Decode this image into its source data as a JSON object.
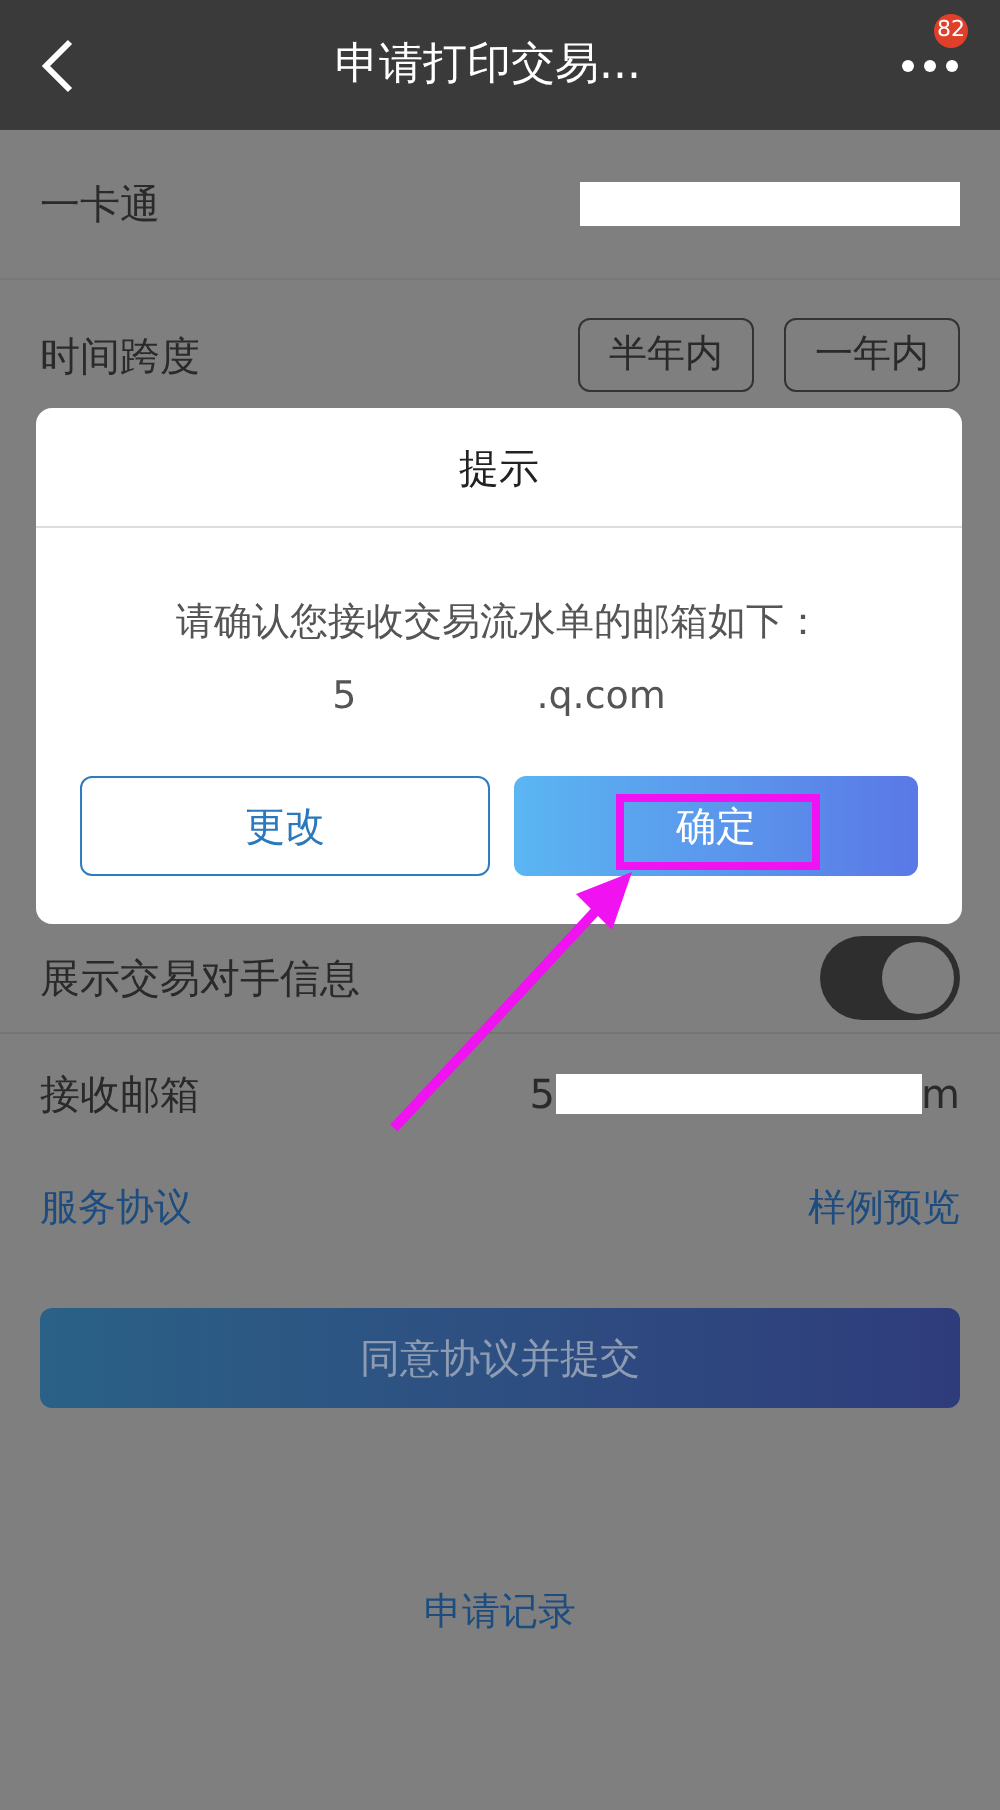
{
  "header": {
    "title": "申请打印交易...",
    "badge": "82"
  },
  "form": {
    "card_label": "一卡通",
    "span_label": "时间跨度",
    "span_options": [
      {
        "label": "半年内",
        "selected": false
      },
      {
        "label": "一年内",
        "selected": false
      }
    ],
    "counterparty_label": "展示交易对手信息",
    "counterparty_on": true,
    "email_label": "接收邮箱",
    "email_start": "5",
    "email_end": "m"
  },
  "links": [
    "服务协议",
    "样例预览"
  ],
  "submit": "同意协议并提交",
  "history_link": "申请记录",
  "dialog": {
    "title": "提示",
    "message": "请确认您接收交易流水单的邮箱如下：",
    "email_start": "5",
    "email_end": ".q.com",
    "buttons": [
      {
        "label": "更改",
        "kind": "secondary"
      },
      {
        "label": "确定",
        "kind": "primary"
      }
    ]
  }
}
